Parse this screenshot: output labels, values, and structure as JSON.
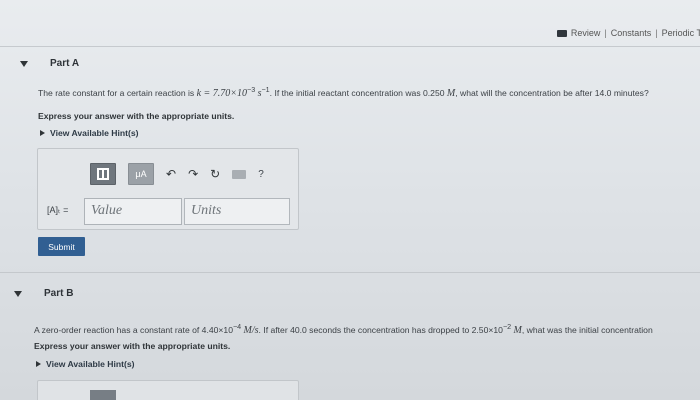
{
  "header_links": {
    "review": "Review",
    "sep1": "|",
    "constants": "Constants",
    "sep2": "|",
    "periodic": "Periodic T"
  },
  "part_a": {
    "title": "Part A",
    "question_pre": "The rate constant for a certain reaction is",
    "k_expr": "k = 7.70×10",
    "k_exp": "−3",
    "k_unit": "s",
    "k_unit_exp": "−1",
    "question_mid": ". If the initial reactant concentration was 0.250",
    "conc_unit": "M",
    "question_post": ", what will the concentration be after 14.0 minutes?",
    "instruction": "Express your answer with the appropriate units.",
    "hints_label": "View Available Hint(s)",
    "toolbar": {
      "templates_icon": "templates-icon",
      "mu_label": "μA",
      "undo_icon": "undo-icon",
      "redo_icon": "redo-icon",
      "reset_icon": "reset-icon",
      "keyboard_icon": "keyboard-icon",
      "help_label": "?"
    },
    "answer_label": "[A]ₜ =",
    "value_placeholder": "Value",
    "units_placeholder": "Units",
    "submit_label": "Submit"
  },
  "part_b": {
    "title": "Part B",
    "question_pre": "A zero-order reaction has a constant rate of 4.40×10",
    "rate_exp": "−4",
    "rate_unit": "M/s",
    "question_mid": ". If after 40.0 seconds the concentration has dropped to 2.50×10",
    "conc_exp": "−2",
    "conc_unit": "M",
    "question_post": ", what was the initial concentration",
    "instruction": "Express your answer with the appropriate units.",
    "hints_label": "View Available Hint(s)"
  },
  "colors": {
    "accent": "#315f92",
    "background": "#e3e6e9"
  }
}
